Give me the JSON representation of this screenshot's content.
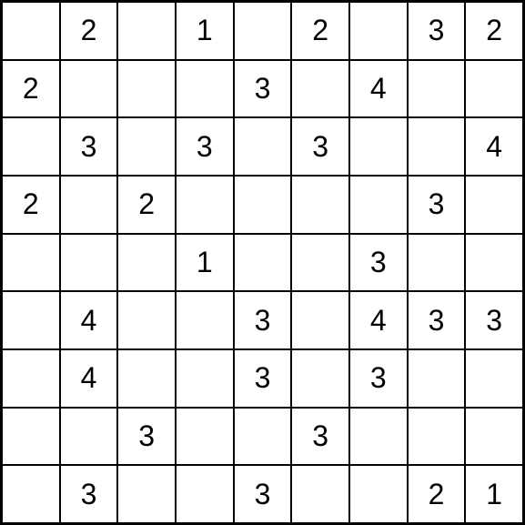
{
  "grid": {
    "size": 9,
    "cells": [
      [
        "",
        "2",
        "",
        "1",
        "",
        "2",
        "",
        "3",
        "2"
      ],
      [
        "2",
        "",
        "",
        "",
        "3",
        "",
        "4",
        "",
        ""
      ],
      [
        "",
        "3",
        "",
        "3",
        "",
        "3",
        "",
        "",
        "4"
      ],
      [
        "2",
        "",
        "2",
        "",
        "",
        "",
        "",
        "3",
        ""
      ],
      [
        "",
        "",
        "",
        "1",
        "",
        "",
        "3",
        "",
        ""
      ],
      [
        "",
        "4",
        "",
        "",
        "3",
        "",
        "4",
        "3",
        "3"
      ],
      [
        "",
        "4",
        "",
        "",
        "3",
        "",
        "3",
        "",
        ""
      ],
      [
        "",
        "",
        "3",
        "",
        "",
        "3",
        "",
        "",
        ""
      ],
      [
        "",
        "3",
        "",
        "",
        "3",
        "",
        "",
        "2",
        "1"
      ]
    ]
  }
}
